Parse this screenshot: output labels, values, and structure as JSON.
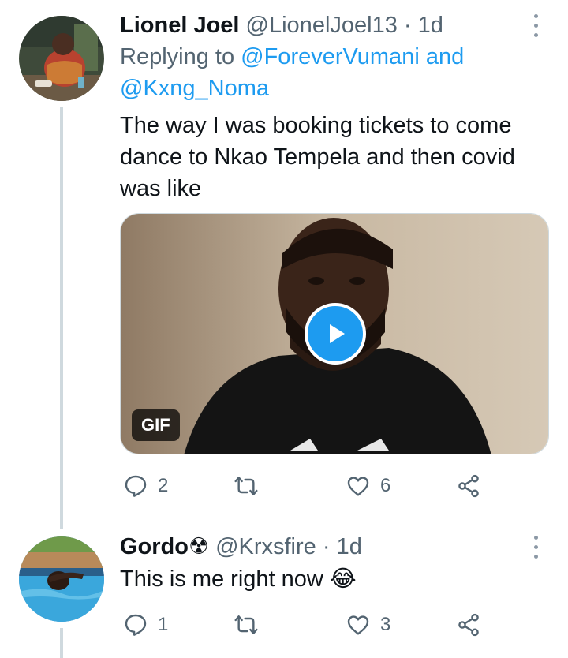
{
  "tweets": [
    {
      "name": "Lionel Joel",
      "handle": "@LionelJoel13",
      "separator": "·",
      "time": "1d",
      "replying_prefix": "Replying to",
      "reply_mention_1": "@ForeverVumani",
      "reply_and": "and",
      "reply_mention_2": "@Kxng_Noma",
      "text_line1": "The way I was booking tickets to come",
      "text_line2": "dance to Nkao Tempela and then covid",
      "text_line3": "was like",
      "media_badge": "GIF",
      "replies": "2",
      "retweets": "",
      "likes": "6"
    },
    {
      "name": "Gordo",
      "name_symbol": "☢",
      "handle": "@Krxsfire",
      "separator": "·",
      "time": "1d",
      "text": "This is me right now",
      "emoji": "😂",
      "replies": "1",
      "retweets": "",
      "likes": "3"
    }
  ],
  "icons": {
    "reply": "speech-bubble-icon",
    "retweet": "retweet-arrows-icon",
    "like": "heart-icon",
    "share": "share-nodes-icon",
    "more": "vertical-ellipsis-icon",
    "play": "play-icon"
  },
  "colors": {
    "link": "#1d9bf0",
    "secondary_text": "#536471",
    "thread_line": "#cfd9de"
  }
}
